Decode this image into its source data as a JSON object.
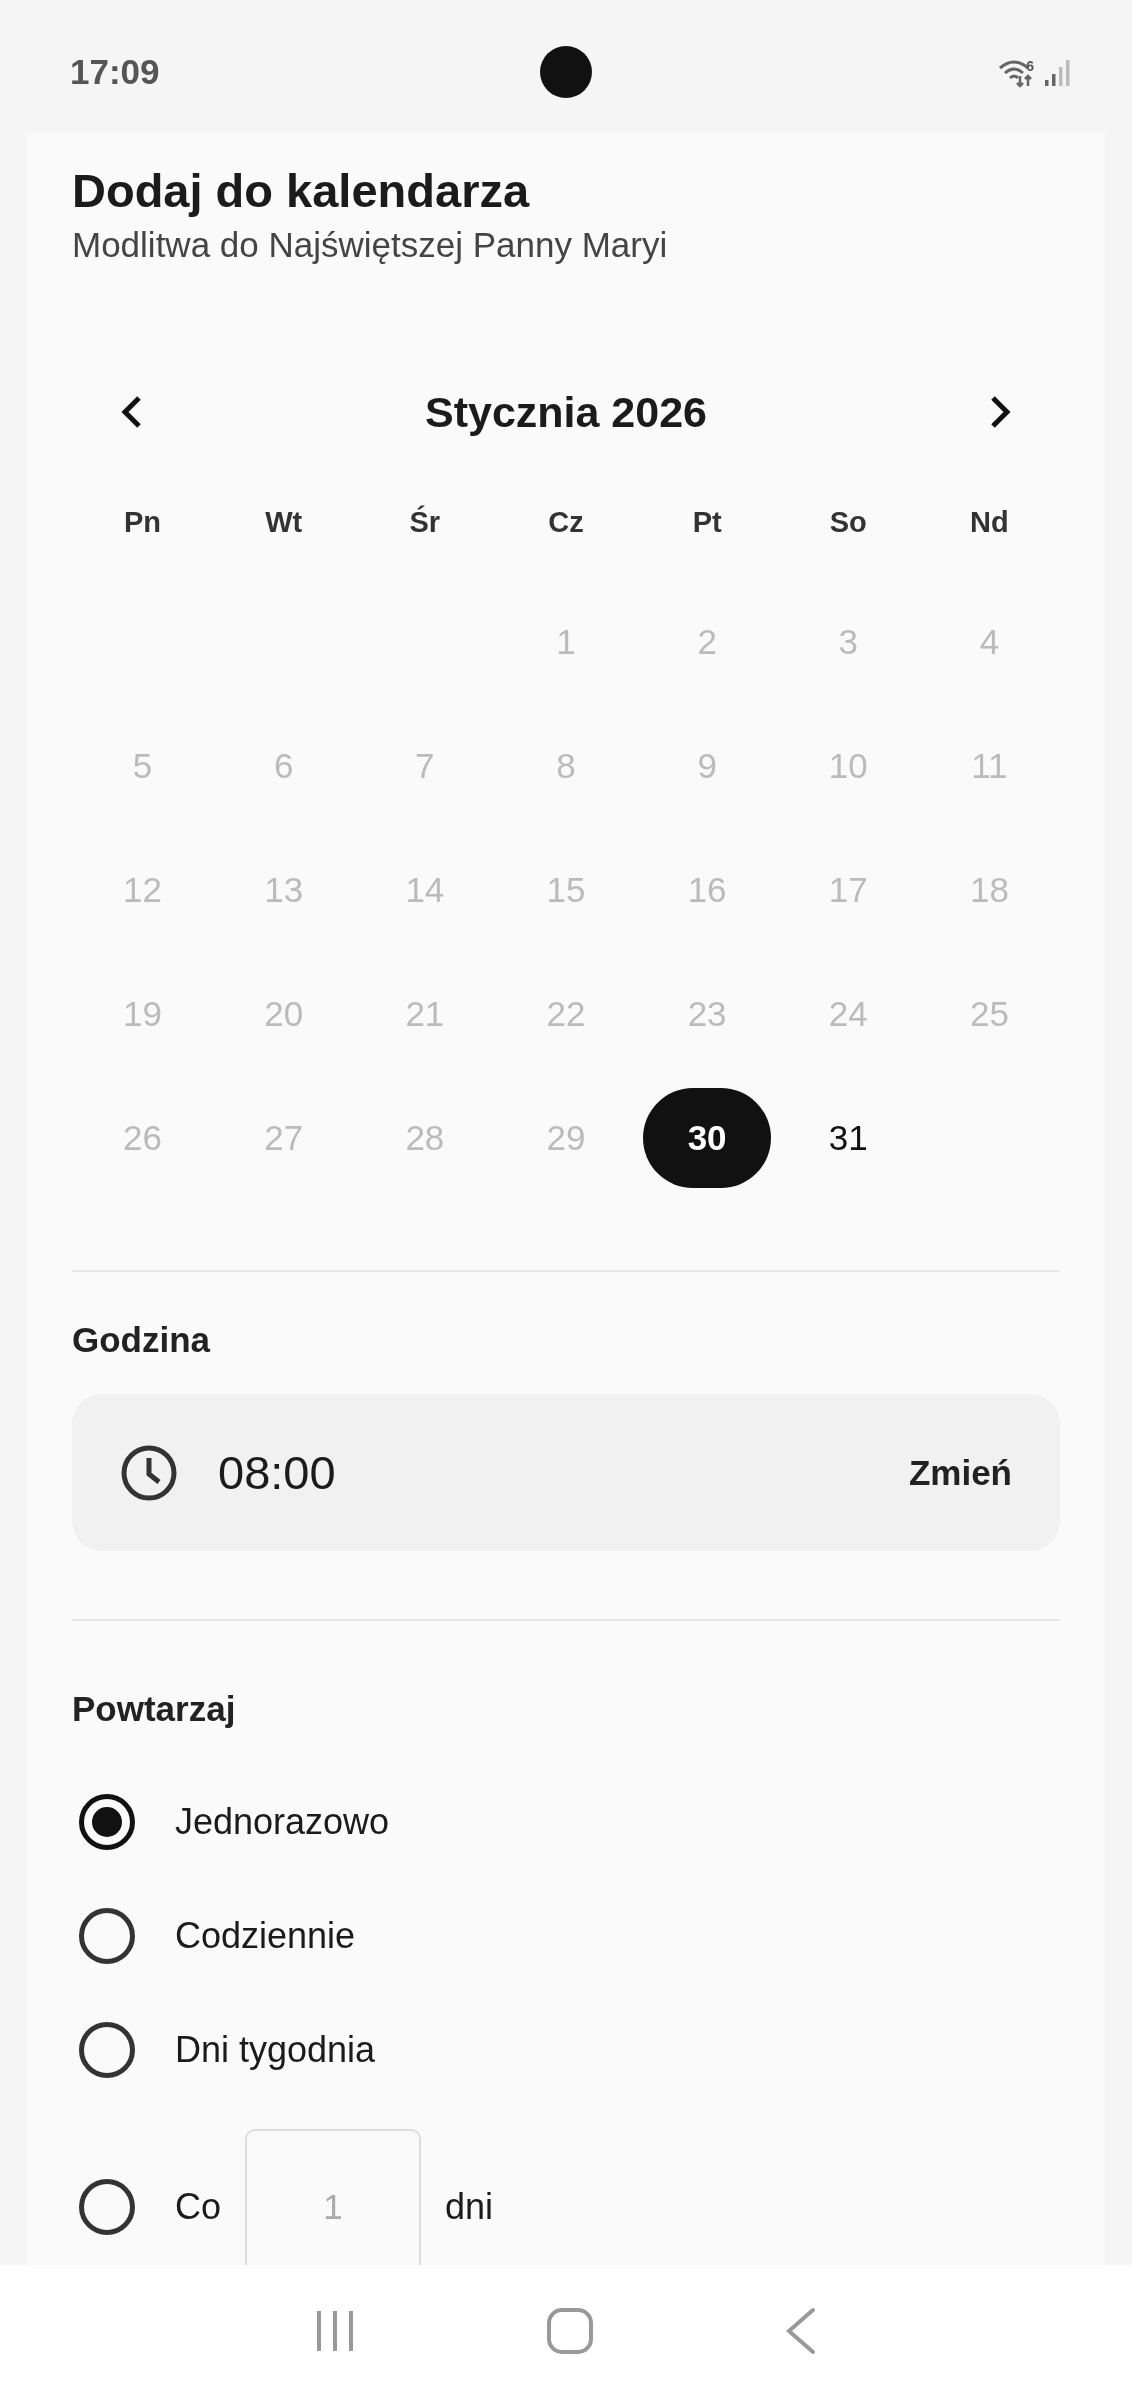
{
  "status_bar": {
    "time": "17:09",
    "wifi_badge": "6"
  },
  "header": {
    "title": "Dodaj do kalendarza",
    "subtitle": "Modlitwa do Najświętszej Panny Maryi"
  },
  "calendar": {
    "month": "Stycznia 2026",
    "weekdays": [
      "Pn",
      "Wt",
      "Śr",
      "Cz",
      "Pt",
      "So",
      "Nd"
    ],
    "weeks": [
      [
        {
          "day": "1",
          "disabled": true,
          "selected": false
        },
        {
          "day": "2",
          "disabled": true,
          "selected": false
        },
        {
          "day": "3",
          "disabled": true,
          "selected": false
        },
        {
          "day": "4",
          "disabled": true,
          "selected": false
        }
      ],
      [
        {
          "day": "5",
          "disabled": true,
          "selected": false
        },
        {
          "day": "6",
          "disabled": true,
          "selected": false
        },
        {
          "day": "7",
          "disabled": true,
          "selected": false
        },
        {
          "day": "8",
          "disabled": true,
          "selected": false
        },
        {
          "day": "9",
          "disabled": true,
          "selected": false
        },
        {
          "day": "10",
          "disabled": true,
          "selected": false
        },
        {
          "day": "11",
          "disabled": true,
          "selected": false
        }
      ],
      [
        {
          "day": "12",
          "disabled": true,
          "selected": false
        },
        {
          "day": "13",
          "disabled": true,
          "selected": false
        },
        {
          "day": "14",
          "disabled": true,
          "selected": false
        },
        {
          "day": "15",
          "disabled": true,
          "selected": false
        },
        {
          "day": "16",
          "disabled": true,
          "selected": false
        },
        {
          "day": "17",
          "disabled": true,
          "selected": false
        },
        {
          "day": "18",
          "disabled": true,
          "selected": false
        }
      ],
      [
        {
          "day": "19",
          "disabled": true,
          "selected": false
        },
        {
          "day": "20",
          "disabled": true,
          "selected": false
        },
        {
          "day": "21",
          "disabled": true,
          "selected": false
        },
        {
          "day": "22",
          "disabled": true,
          "selected": false
        },
        {
          "day": "23",
          "disabled": true,
          "selected": false
        },
        {
          "day": "24",
          "disabled": true,
          "selected": false
        },
        {
          "day": "25",
          "disabled": true,
          "selected": false
        }
      ],
      [
        {
          "day": "26",
          "disabled": true,
          "selected": false
        },
        {
          "day": "27",
          "disabled": true,
          "selected": false
        },
        {
          "day": "28",
          "disabled": true,
          "selected": false
        },
        {
          "day": "29",
          "disabled": true,
          "selected": false
        },
        {
          "day": "30",
          "disabled": false,
          "selected": true
        },
        {
          "day": "31",
          "disabled": false,
          "selected": false
        }
      ]
    ]
  },
  "time_section": {
    "label": "Godzina",
    "time": "08:00",
    "change_button": "Zmień"
  },
  "repeat_section": {
    "label": "Powtarzaj",
    "options": [
      {
        "kind": "plain",
        "label": "Jednorazowo",
        "selected": true
      },
      {
        "kind": "plain",
        "label": "Codziennie",
        "selected": false
      },
      {
        "kind": "plain",
        "label": "Dni tygodnia",
        "selected": false
      },
      {
        "kind": "interval",
        "label": "Co",
        "placeholder": "1",
        "suffix": "dni",
        "selected": false
      }
    ]
  }
}
